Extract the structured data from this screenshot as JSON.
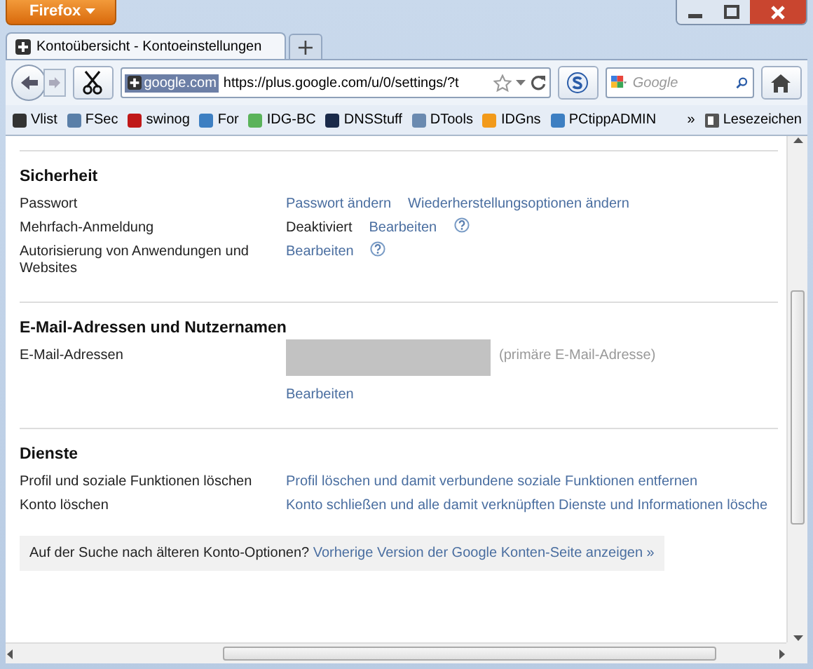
{
  "window": {
    "menu_button": "Firefox"
  },
  "tabs": [
    {
      "label": "Kontoübersicht - Kontoeinstellungen",
      "selected": true
    }
  ],
  "new_tab_button": "+",
  "address_bar": {
    "site_badge": "google.com",
    "url": "https://plus.google.com/u/0/settings/?t"
  },
  "search_bar": {
    "placeholder": "Google"
  },
  "bookmarks": [
    {
      "label": "Vlist",
      "color": "#333333"
    },
    {
      "label": "FSec",
      "color": "#5a7fa8"
    },
    {
      "label": "swinog",
      "color": "#c01818"
    },
    {
      "label": "For",
      "color": "#3d7fc2"
    },
    {
      "label": "IDG-BC",
      "color": "#5ab35a"
    },
    {
      "label": "DNSStuff",
      "color": "#1a2a4a"
    },
    {
      "label": "DTools",
      "color": "#6a8ab0"
    },
    {
      "label": "IDGns",
      "color": "#f29a1a"
    },
    {
      "label": "PCtippADMIN",
      "color": "#3d7fc2"
    }
  ],
  "bookmarks_overflow": "»",
  "bookmarks_menu": "Lesezeichen",
  "sections": [
    {
      "title": "Sicherheit",
      "rows": [
        {
          "label": "Passwort",
          "items": [
            {
              "kind": "link",
              "text": "Passwort ändern"
            },
            {
              "kind": "link",
              "text": "Wiederherstellungsoptionen ändern"
            }
          ]
        },
        {
          "label": "Mehrfach-Anmeldung",
          "items": [
            {
              "kind": "text",
              "text": "Deaktiviert"
            },
            {
              "kind": "link",
              "text": "Bearbeiten"
            },
            {
              "kind": "help"
            }
          ]
        },
        {
          "label": "Autorisierung von Anwendungen und Websites",
          "items": [
            {
              "kind": "link",
              "text": "Bearbeiten"
            },
            {
              "kind": "help"
            }
          ]
        }
      ]
    },
    {
      "title": "E-Mail-Adressen und Nutzernamen",
      "rows": [
        {
          "label": "E-Mail-Adressen",
          "items": [
            {
              "kind": "redacted"
            },
            {
              "kind": "hint",
              "text": "(primäre E-Mail-Adresse)"
            },
            {
              "kind": "break"
            },
            {
              "kind": "link",
              "text": "Bearbeiten"
            }
          ]
        }
      ]
    },
    {
      "title": "Dienste",
      "rows": [
        {
          "label": "Profil und soziale Funktionen löschen",
          "items": [
            {
              "kind": "link",
              "text": "Profil löschen und damit verbundene soziale Funktionen entfernen"
            }
          ]
        },
        {
          "label": "Konto löschen",
          "items": [
            {
              "kind": "link",
              "text": "Konto schließen und alle damit verknüpften Dienste und Informationen lösche"
            }
          ]
        }
      ]
    }
  ],
  "footer": {
    "text": "Auf der Suche nach älteren Konto-Optionen?",
    "link": "Vorherige Version der Google Konten-Seite anzeigen »"
  }
}
